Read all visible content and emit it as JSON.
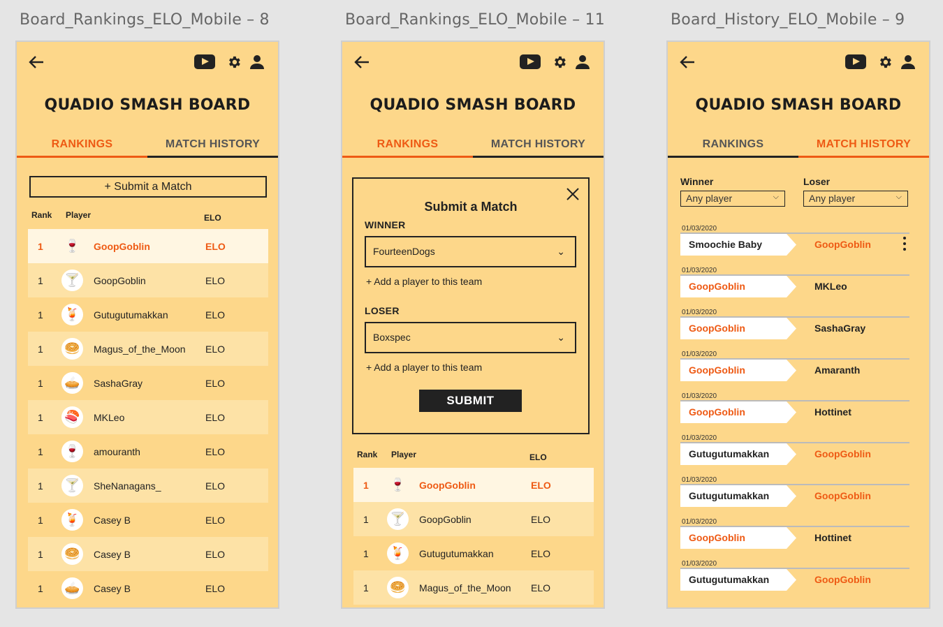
{
  "frames": [
    {
      "title": "Board_Rankings_ELO_Mobile – 8"
    },
    {
      "title": "Board_Rankings_ELO_Mobile – 11"
    },
    {
      "title": "Board_History_ELO_Mobile – 9"
    }
  ],
  "board_title": "QUADIO SMASH BOARD",
  "tabs": {
    "rankings": "RANKINGS",
    "history": "MATCH HISTORY"
  },
  "submit_button": "+ Submit a Match",
  "table_headers": {
    "rank": "Rank",
    "player": "Player",
    "elo": "ELO"
  },
  "rankings": [
    {
      "rank": "1",
      "icon": "🍷",
      "player": "GoopGoblin",
      "elo": "ELO"
    },
    {
      "rank": "1",
      "icon": "🍸",
      "player": "GoopGoblin",
      "elo": "ELO"
    },
    {
      "rank": "1",
      "icon": "🍹",
      "player": "Gutugutumakkan",
      "elo": "ELO"
    },
    {
      "rank": "1",
      "icon": "🥯",
      "player": "Magus_of_the_Moon",
      "elo": "ELO"
    },
    {
      "rank": "1",
      "icon": "🥧",
      "player": "SashaGray",
      "elo": "ELO"
    },
    {
      "rank": "1",
      "icon": "🍣",
      "player": "MKLeo",
      "elo": "ELO"
    },
    {
      "rank": "1",
      "icon": "🍷",
      "player": "amouranth",
      "elo": "ELO"
    },
    {
      "rank": "1",
      "icon": "🍸",
      "player": "SheNanagans_",
      "elo": "ELO"
    },
    {
      "rank": "1",
      "icon": "🍹",
      "player": "Casey B",
      "elo": "ELO"
    },
    {
      "rank": "1",
      "icon": "🥯",
      "player": "Casey B",
      "elo": "ELO"
    },
    {
      "rank": "1",
      "icon": "🥧",
      "player": "Casey B",
      "elo": "ELO"
    }
  ],
  "modal": {
    "title": "Submit a Match",
    "winner_label": "WINNER",
    "winner_value": "FourteenDogs",
    "loser_label": "LOSER",
    "loser_value": "Boxspec",
    "add_player": "+ Add a player to this team",
    "submit": "SUBMIT"
  },
  "filters": {
    "winner_label": "Winner",
    "loser_label": "Loser",
    "winner_value": "Any player",
    "loser_value": "Any player"
  },
  "matches": [
    {
      "date": "01/03/2020",
      "p1": "Smoochie Baby",
      "p1_win": false,
      "p2": "GoopGoblin",
      "p2_win": true
    },
    {
      "date": "01/03/2020",
      "p1": "GoopGoblin",
      "p1_win": true,
      "p2": "MKLeo",
      "p2_win": false
    },
    {
      "date": "01/03/2020",
      "p1": "GoopGoblin",
      "p1_win": true,
      "p2": "SashaGray",
      "p2_win": false
    },
    {
      "date": "01/03/2020",
      "p1": "GoopGoblin",
      "p1_win": true,
      "p2": "Amaranth",
      "p2_win": false
    },
    {
      "date": "01/03/2020",
      "p1": "GoopGoblin",
      "p1_win": true,
      "p2": "Hottinet",
      "p2_win": false
    },
    {
      "date": "01/03/2020",
      "p1": "Gutugutumakkan",
      "p1_win": false,
      "p2": "GoopGoblin",
      "p2_win": true
    },
    {
      "date": "01/03/2020",
      "p1": "Gutugutumakkan",
      "p1_win": false,
      "p2": "GoopGoblin",
      "p2_win": true
    },
    {
      "date": "01/03/2020",
      "p1": "GoopGoblin",
      "p1_win": true,
      "p2": "Hottinet",
      "p2_win": false
    },
    {
      "date": "01/03/2020",
      "p1": "Gutugutumakkan",
      "p1_win": false,
      "p2": "GoopGoblin",
      "p2_win": true
    }
  ],
  "colors": {
    "accent": "#ee5a14",
    "background": "#fdd78a",
    "dark": "#222222"
  }
}
